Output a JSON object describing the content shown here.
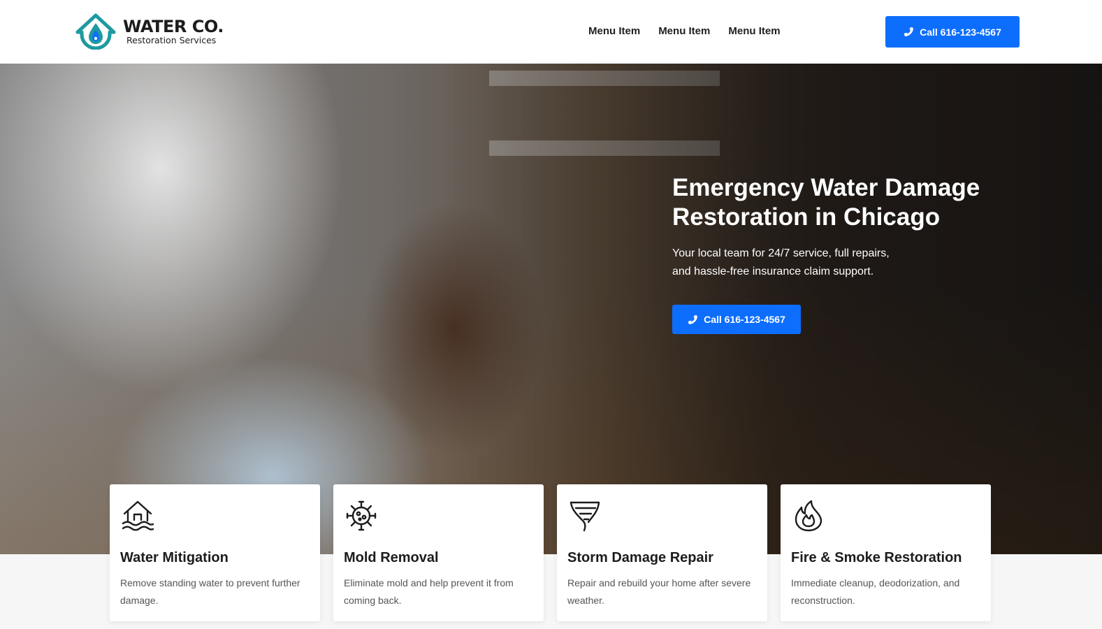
{
  "brand": {
    "name": "WATER CO.",
    "tagline": "Restoration Services",
    "accent_color": "#0d6efd",
    "logo_color": "#1e9aa0"
  },
  "nav": {
    "items": [
      {
        "label": "Menu Item"
      },
      {
        "label": "Menu Item"
      },
      {
        "label": "Menu Item"
      }
    ]
  },
  "header_cta": {
    "label": "Call 616-123-4567",
    "icon": "phone-icon"
  },
  "hero": {
    "title": "Emergency Water Damage Restoration in Chicago",
    "subtitle": "Your local team for 24/7 service, full repairs, and hassle-free insurance claim support.",
    "cta_label": "Call 616-123-4567",
    "cta_icon": "phone-icon"
  },
  "services": [
    {
      "icon": "house-water-icon",
      "title": "Water Mitigation",
      "description": "Remove standing water to prevent further damage."
    },
    {
      "icon": "mold-spore-icon",
      "title": "Mold Removal",
      "description": "Eliminate mold and help prevent it from coming back."
    },
    {
      "icon": "tornado-icon",
      "title": "Storm Damage Repair",
      "description": "Repair and rebuild your home after severe weather."
    },
    {
      "icon": "fire-icon",
      "title": "Fire & Smoke Restoration",
      "description": "Immediate cleanup, deodorization, and reconstruction."
    }
  ]
}
